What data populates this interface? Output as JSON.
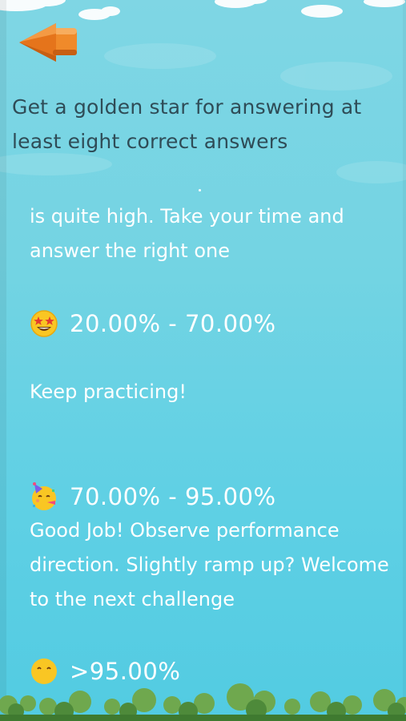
{
  "intro_text": "Get a golden star for answering at least eight correct answers",
  "levels": [
    {
      "description": "is quite high. Take your time and answer the right one"
    },
    {
      "emoji": "star-struck-emoji",
      "range": "20.00% - 70.00%",
      "message": "Keep practicing!"
    },
    {
      "emoji": "party-face-emoji",
      "range": "70.00% - 95.00%",
      "message": "Good Job! Observe performance direction. Slightly ramp up? Welcome to the next challenge"
    },
    {
      "emoji": "smiling-face-emoji",
      "range": ">95.00%"
    }
  ],
  "back_icon": "back-arrow-icon",
  "colors": {
    "sky_top": "#7fd6e4",
    "sky_bottom": "#52cbe2",
    "intro_text": "#2f4c57",
    "level_text": "#ffffff",
    "back_button": "#f08a2a",
    "ground": "#4e8a3a"
  }
}
